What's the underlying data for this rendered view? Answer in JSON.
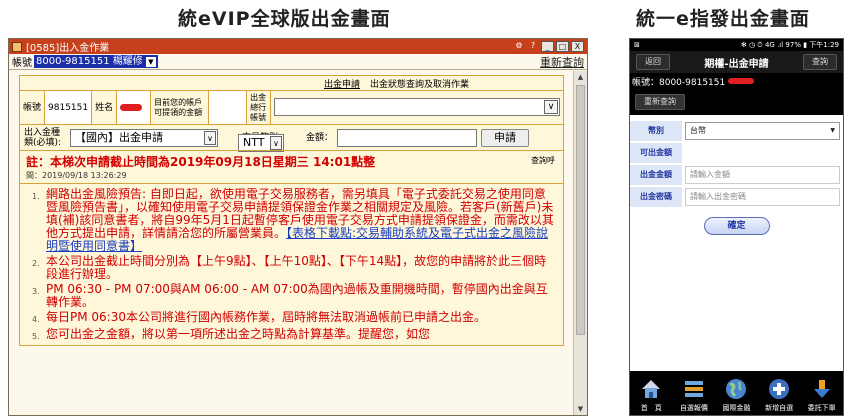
{
  "headings": {
    "left": "統eVIP全球版出金畫面",
    "right": "統一e指發出金畫面"
  },
  "evip": {
    "window_title": "[0585]出入金作業",
    "title_icons": {
      "help": "?",
      "minimize": "_",
      "maximize": "□",
      "close": "X"
    },
    "account_label": "帳號",
    "account_value": "8000-9815151 楊耀修",
    "refresh": "重新查詢",
    "tabs": [
      "出金申請",
      "出金狀態查詢及取消作業"
    ],
    "account_cell_label": "帳號",
    "account_cell_value": "9815151",
    "name_label": "姓名",
    "withdrawable_label": "目前您的帳戶可提領的金額",
    "out_account_label": "出金總行帳號",
    "out_type_label": "出入金種類(必填):",
    "out_type_value": "【國內】出金申請",
    "currency_label": "交易幣別：",
    "currency_value": "NTT",
    "amount_label": "金額：",
    "apply_button": "申請",
    "deadline_notice": "註：本梯次申請截止時間為2019年09月18日星期三 14:01點整",
    "notice_time": "間：2019/09/18 13:26:29",
    "query_hint": "查詢呼",
    "notices": [
      {
        "num": "1.",
        "text": "網路出金風險預告: 自即日起，欲使用電子交易服務者，需另填具「電子式委託交易之使用同意暨風險預告書」，以確知使用電子交易申請提領保證金作業之相關規定及風險。若客戶(新舊戶)未填(補)該同意書者，將自99年5月1日起暫停客戶使用電子交易方式申請提領保證金，而需改以其他方式提出申請，詳情請洽您的所屬營業員。",
        "link": "【表格下載點:交易輔助系統及電子式出金之風險說明暨使用同意書】"
      },
      {
        "num": "2.",
        "text": "本公司出金截止時間分別為【上午9點】、【上午10點】、【下午14點】，故您的申請將於此三個時段進行辦理。",
        "link": ""
      },
      {
        "num": "3.",
        "text": "PM 06:30 - PM 07:00與AM 06:00 - AM 07:00為國內過帳及重開機時間，暫停國內出金與互轉作業。",
        "link": ""
      },
      {
        "num": "4.",
        "text": "每日PM 06:30本公司將進行國內帳務作業，屆時將無法取消過帳前已申請之出金。",
        "link": ""
      },
      {
        "num": "5.",
        "text": "您可出金之金額，將以第一項所述出金之時點為計算基準。提醒您，如您",
        "link": ""
      }
    ]
  },
  "phone": {
    "status_left": "⊠",
    "status_right": "✻ ◷ ⏱ 4G .ıl 97% ▮ 下午1:29",
    "back": "返回",
    "title": "期權-出金申請",
    "query": "查詢",
    "account_label": "帳號：8000-9815151",
    "requery": "重新查詢",
    "currency_label": "幣別",
    "currency_value": "台幣",
    "available_label": "可出金額",
    "amount_label": "出金金額",
    "amount_placeholder": "請輸入金額",
    "password_label": "出金密碼",
    "password_placeholder": "請輸入出金密碼",
    "confirm": "確定",
    "bottom_nav": [
      "首　頁",
      "自選報價",
      "國際金融",
      "新增自選",
      "委託下單"
    ],
    "colors": {
      "nav_bg": "#000000",
      "label_bg": "#dde6f6",
      "label_fg": "#2035a0"
    }
  }
}
